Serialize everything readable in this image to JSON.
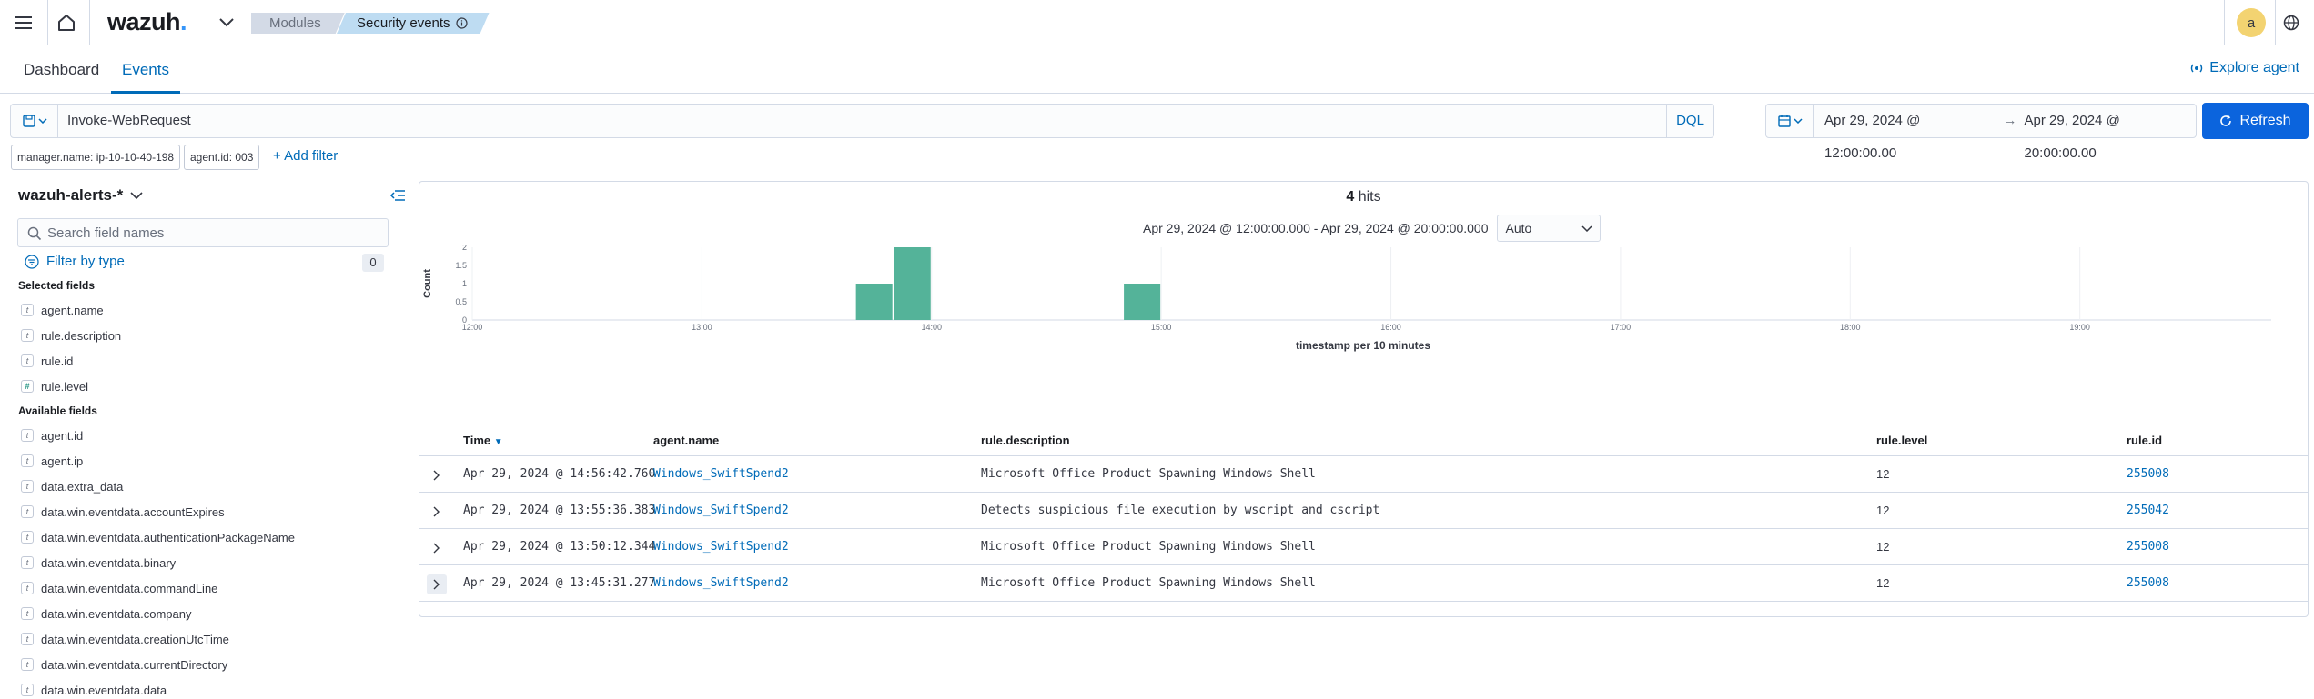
{
  "app": {
    "logo_text": "wazuh",
    "logo_dot": ".",
    "breadcrumbs": [
      "Modules",
      "Security events"
    ],
    "user_initial": "a"
  },
  "tabs": [
    {
      "label": "Dashboard"
    },
    {
      "label": "Events"
    }
  ],
  "explore_agent_label": "Explore agent",
  "search": {
    "query": "Invoke-WebRequest",
    "language": "DQL"
  },
  "time": {
    "start": "Apr 29, 2024 @ 12:00:00.00",
    "end": "Apr 29, 2024 @ 20:00:00.00",
    "arrow": "→"
  },
  "refresh_label": "Refresh",
  "filters": [
    {
      "label": "manager.name: ip-10-10-40-198"
    },
    {
      "label": "agent.id: 003"
    }
  ],
  "add_filter_label": "+ Add filter",
  "sidebar": {
    "index_pattern": "wazuh-alerts-*",
    "search_placeholder": "Search field names",
    "filter_by_type": "Filter by type",
    "filter_count": "0",
    "selected_title": "Selected fields",
    "selected_fields": [
      {
        "type": "t",
        "name": "agent.name"
      },
      {
        "type": "t",
        "name": "rule.description"
      },
      {
        "type": "t",
        "name": "rule.id"
      },
      {
        "type": "#",
        "name": "rule.level"
      }
    ],
    "available_title": "Available fields",
    "available_fields": [
      {
        "type": "t",
        "name": "agent.id"
      },
      {
        "type": "t",
        "name": "agent.ip"
      },
      {
        "type": "t",
        "name": "data.extra_data"
      },
      {
        "type": "t",
        "name": "data.win.eventdata.accountExpires"
      },
      {
        "type": "t",
        "name": "data.win.eventdata.authenticationPackageName"
      },
      {
        "type": "t",
        "name": "data.win.eventdata.binary"
      },
      {
        "type": "t",
        "name": "data.win.eventdata.commandLine"
      },
      {
        "type": "t",
        "name": "data.win.eventdata.company"
      },
      {
        "type": "t",
        "name": "data.win.eventdata.creationUtcTime"
      },
      {
        "type": "t",
        "name": "data.win.eventdata.currentDirectory"
      },
      {
        "type": "t",
        "name": "data.win.eventdata.data"
      }
    ]
  },
  "histogram": {
    "hits_count": "4",
    "hits_label": "hits",
    "range_label": "Apr 29, 2024 @ 12:00:00.000 - Apr 29, 2024 @ 20:00:00.000",
    "interval": "Auto"
  },
  "chart_data": {
    "type": "bar",
    "ylabel": "Count",
    "xlabel": "timestamp per 10 minutes",
    "ylim": [
      0,
      2
    ],
    "yticks": [
      "0",
      "0.5",
      "1",
      "1.5",
      "2"
    ],
    "xticks": [
      "12:00",
      "13:00",
      "14:00",
      "15:00",
      "16:00",
      "17:00",
      "18:00",
      "19:00"
    ],
    "x_unit_minutes_from": "12:00",
    "bars": [
      {
        "x": "13:40",
        "value": 1
      },
      {
        "x": "13:50",
        "value": 2
      },
      {
        "x": "14:50",
        "value": 1
      }
    ],
    "bar_color": "#54b399",
    "grid": true
  },
  "table": {
    "columns": [
      "Time",
      "agent.name",
      "rule.description",
      "rule.level",
      "rule.id"
    ],
    "rows": [
      {
        "time": "Apr 29, 2024 @ 14:56:42.760",
        "agent": "Windows_SwiftSpend2",
        "desc": "Microsoft Office Product Spawning Windows Shell",
        "level": "12",
        "id": "255008"
      },
      {
        "time": "Apr 29, 2024 @ 13:55:36.383",
        "agent": "Windows_SwiftSpend2",
        "desc": "Detects suspicious file execution by wscript and cscript",
        "level": "12",
        "id": "255042"
      },
      {
        "time": "Apr 29, 2024 @ 13:50:12.344",
        "agent": "Windows_SwiftSpend2",
        "desc": "Microsoft Office Product Spawning Windows Shell",
        "level": "12",
        "id": "255008"
      },
      {
        "time": "Apr 29, 2024 @ 13:45:31.277",
        "agent": "Windows_SwiftSpend2",
        "desc": "Microsoft Office Product Spawning Windows Shell",
        "level": "12",
        "id": "255008"
      }
    ]
  }
}
